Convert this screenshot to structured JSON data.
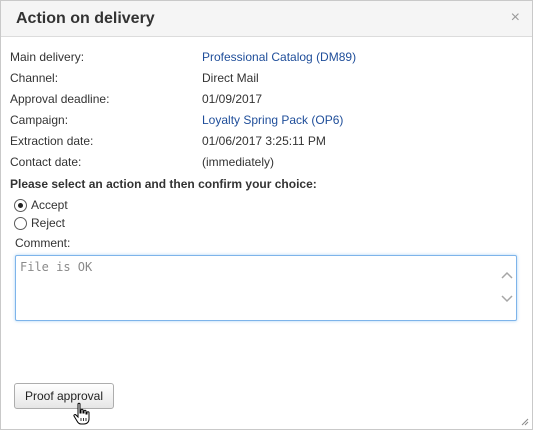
{
  "dialog": {
    "title": "Action on delivery",
    "close_symbol": "×"
  },
  "info": [
    {
      "label": "Main delivery:",
      "value": "Professional Catalog (DM89)",
      "is_link": true
    },
    {
      "label": "Channel:",
      "value": "Direct Mail",
      "is_link": false
    },
    {
      "label": "Approval deadline:",
      "value": "01/09/2017",
      "is_link": false
    },
    {
      "label": "Campaign:",
      "value": "Loyalty Spring Pack (OP6)",
      "is_link": true
    },
    {
      "label": "Extraction date:",
      "value": "01/06/2017 3:25:11 PM",
      "is_link": false
    },
    {
      "label": "Contact date:",
      "value": "(immediately)",
      "is_link": false
    }
  ],
  "action": {
    "prompt": "Please select an action and then confirm your choice:",
    "options": [
      {
        "label": "Accept",
        "selected": true
      },
      {
        "label": "Reject",
        "selected": false
      }
    ]
  },
  "comment": {
    "label": "Comment:",
    "value": "",
    "placeholder": "File is OK"
  },
  "buttons": {
    "proof_approval": "Proof approval"
  },
  "colors": {
    "link": "#1f4e9a",
    "focus_border": "#7eb4ea",
    "titlebar_bg": "#f5f5f5"
  },
  "icons": [
    "close-icon",
    "scroll-up-icon",
    "scroll-down-icon",
    "hand-cursor-icon",
    "resize-grip-icon"
  ]
}
